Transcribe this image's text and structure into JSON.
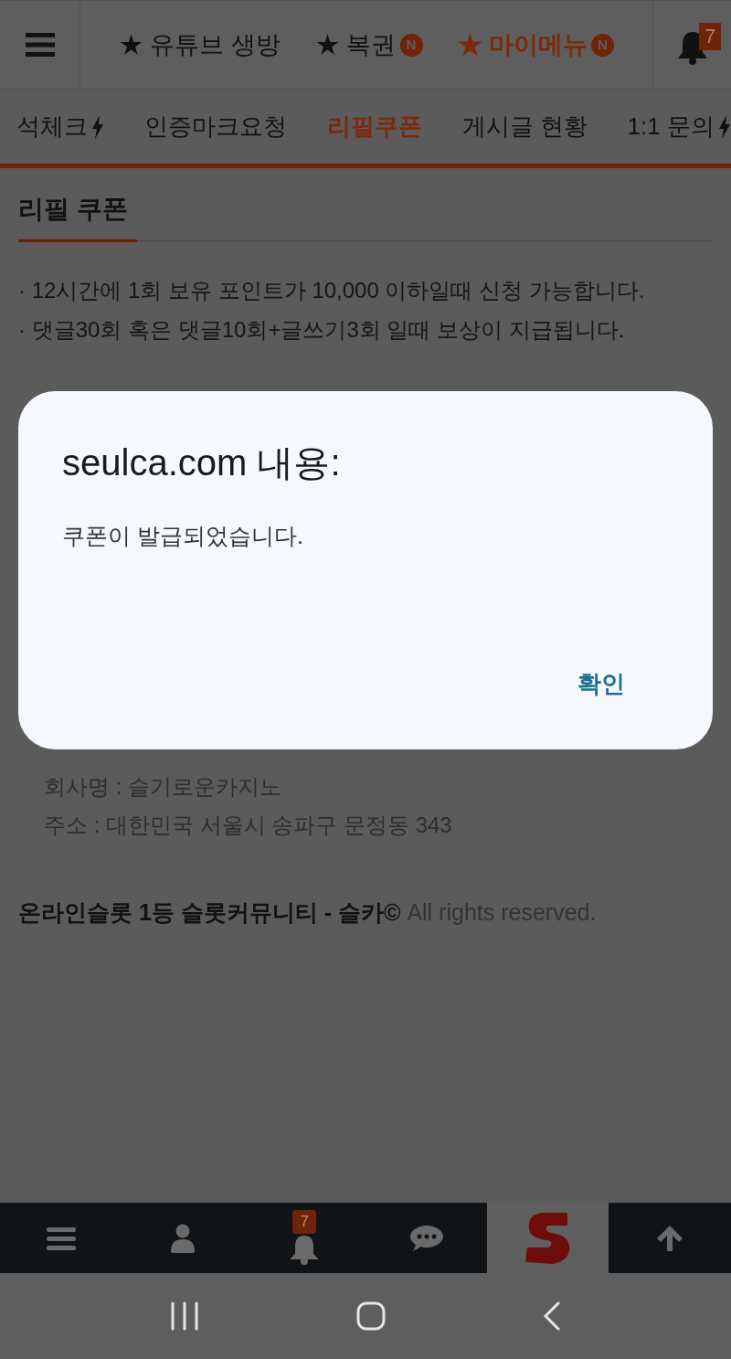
{
  "header": {
    "links": [
      {
        "label": "★ 유튜브 생방",
        "selected": false
      },
      {
        "label": "★ 복권",
        "badge": "N",
        "selected": false
      },
      {
        "label": "★ 마이메뉴",
        "badge": "N",
        "selected": true
      }
    ],
    "bell_count": "7"
  },
  "tabs": [
    {
      "label": "석체크",
      "bolt": true,
      "selected": false
    },
    {
      "label": "인증마크요청",
      "bolt": false,
      "selected": false
    },
    {
      "label": "리필쿠폰",
      "bolt": false,
      "selected": true
    },
    {
      "label": "게시글 현황",
      "bolt": false,
      "selected": false
    },
    {
      "label": "1:1 문의",
      "bolt": true,
      "selected": false
    }
  ],
  "section_title": "리필 쿠폰",
  "notes": [
    "· 12시간에 1회 보유 포인트가 10,000 이하일때 신청 가능합니다.",
    "· 댓글30회 혹은 댓글10회+글쓰기3회 일때 보상이 지급됩니다."
  ],
  "company": [
    "회사명 : 슬기로운카지노",
    "주소 : 대한민국 서울시 송파구 문정동 343"
  ],
  "footer": {
    "brand": "온라인슬롯 1등 슬롯커뮤니티 - 슬카©",
    "rights": "All rights reserved."
  },
  "dialog": {
    "title": "seulca.com 내용:",
    "message": "쿠폰이 발급되었습니다.",
    "button": "확인"
  },
  "bottom_nav": [
    {
      "kind": "menu"
    },
    {
      "kind": "user"
    },
    {
      "kind": "bell",
      "badge": "7"
    },
    {
      "kind": "chat"
    },
    {
      "kind": "logo"
    },
    {
      "kind": "up"
    }
  ]
}
